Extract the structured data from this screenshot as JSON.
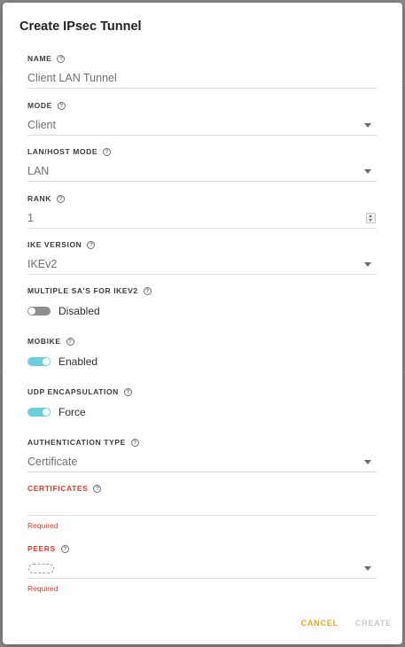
{
  "dialog": {
    "title": "Create IPsec Tunnel",
    "help_glyph": "?"
  },
  "fields": {
    "name": {
      "label": "NAME",
      "value": "Client LAN Tunnel"
    },
    "mode": {
      "label": "MODE",
      "value": "Client"
    },
    "lan_host_mode": {
      "label": "LAN/HOST MODE",
      "value": "LAN"
    },
    "rank": {
      "label": "RANK",
      "value": "1"
    },
    "ike_version": {
      "label": "IKE VERSION",
      "value": "IKEv2"
    },
    "multiple_sas": {
      "label": "MULTIPLE SA'S FOR IKEV2",
      "state": "Disabled",
      "on": false
    },
    "mobike": {
      "label": "MOBIKE",
      "state": "Enabled",
      "on": true
    },
    "udp_encapsulation": {
      "label": "UDP ENCAPSULATION",
      "state": "Force",
      "on": true
    },
    "authentication_type": {
      "label": "AUTHENTICATION TYPE",
      "value": "Certificate"
    },
    "certificates": {
      "label": "CERTIFICATES",
      "value": "",
      "error": "Required"
    },
    "peers": {
      "label": "PEERS",
      "value": "",
      "error": "Required"
    }
  },
  "actions": {
    "cancel_label": "CANCEL",
    "create_label": "CREATE"
  },
  "colors": {
    "accent_toggle": "#6cd0dc",
    "error": "#e0392b",
    "cancel": "#f0a020",
    "disabled": "#c9c9c9"
  },
  "icons": {
    "help": "help-circle-icon",
    "dropdown": "chevron-down-icon",
    "stepper": "number-stepper-icon"
  }
}
